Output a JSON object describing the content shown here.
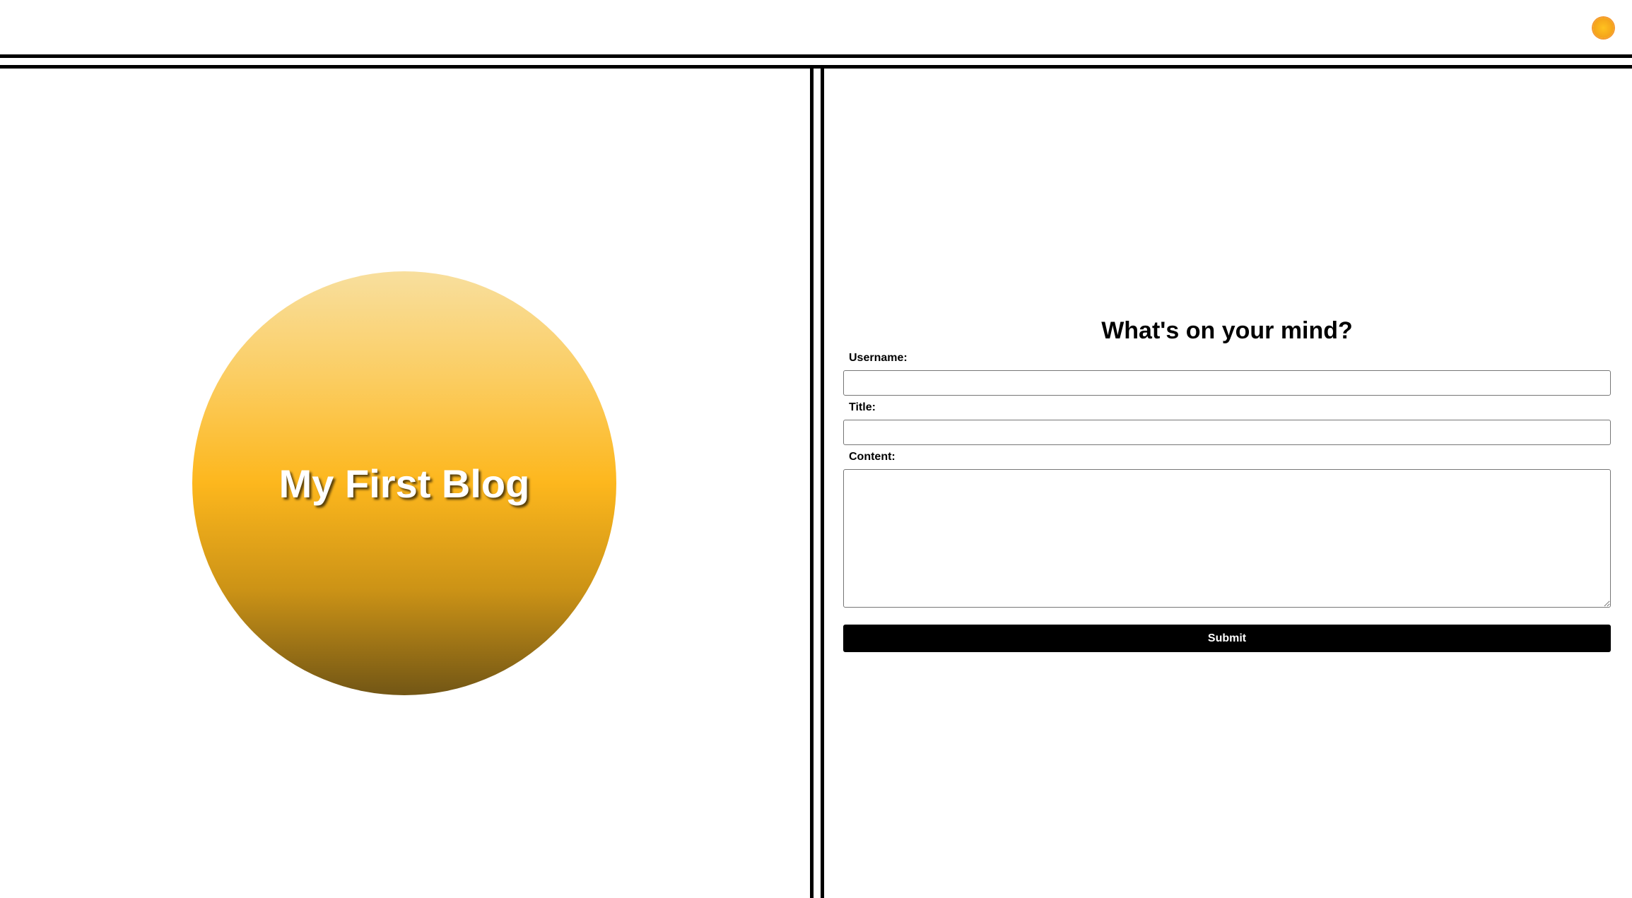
{
  "header": {
    "theme_toggle_icon": "sun-icon",
    "theme_toggle_color": "#f4a21a"
  },
  "hero": {
    "title": "My First Blog",
    "gradient_top": "#f8df9e",
    "gradient_mid": "#fdb71d",
    "gradient_bottom": "#725615"
  },
  "form": {
    "heading": "What's on your mind?",
    "username_label": "Username:",
    "username_value": "",
    "title_label": "Title:",
    "title_value": "",
    "content_label": "Content:",
    "content_value": "",
    "submit_label": "Submit",
    "submit_color": "#000000"
  }
}
